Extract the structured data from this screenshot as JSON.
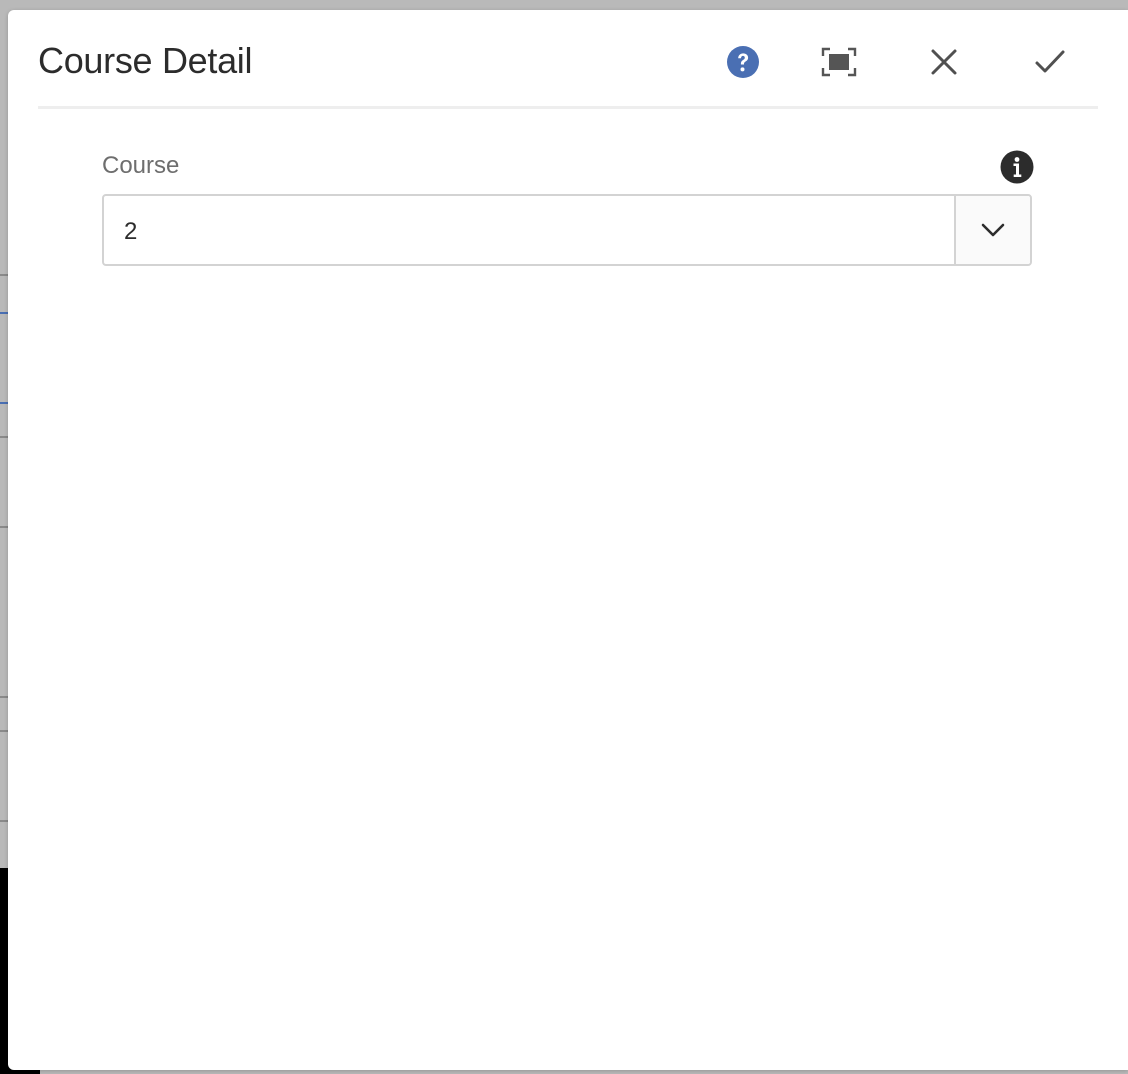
{
  "dialog": {
    "title": "Course Detail",
    "actions": {
      "help_icon": "help-circle-icon",
      "fullscreen_icon": "fullscreen-icon",
      "close_icon": "close-icon",
      "done_icon": "checkmark-icon"
    }
  },
  "form": {
    "course_field": {
      "label": "Course",
      "value": "2",
      "info_icon": "info-icon",
      "toggle_icon": "chevron-down-icon"
    }
  },
  "colors": {
    "accent_blue": "#4a6fb3",
    "text_primary": "#2c2c2c",
    "text_label": "#6e6e6e",
    "border": "#d3d3d3",
    "backdrop": "#b9b9b9"
  }
}
